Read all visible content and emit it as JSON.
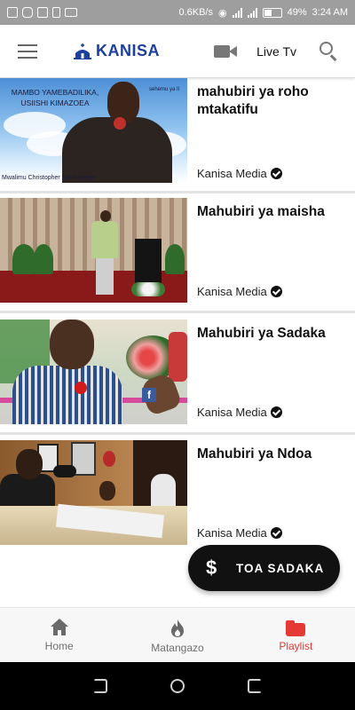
{
  "status_bar": {
    "network_speed": "0.6KB/s",
    "battery": "49%",
    "battery_level": 0.49,
    "time": "3:24 AM"
  },
  "header": {
    "brand": "KANISA",
    "live_tv_label": "Live Tv",
    "icons": {
      "menu": "menu-icon",
      "logo": "church-logo-icon",
      "video": "video-camera-icon",
      "search": "search-icon"
    },
    "brand_color": "#1a3fa0"
  },
  "videos": [
    {
      "title": "mahubiri ya roho mtakatifu",
      "channel": "Kanisa Media",
      "thumbnail": {
        "overlay_text": "MAMBO YAMEBADILIKA, USIISHI KIMAZOEA",
        "tag_text": "sehemu ya II",
        "caption": "Mwalimu Christopher Mwakasege"
      }
    },
    {
      "title": "Mahubiri ya maisha",
      "channel": "Kanisa Media"
    },
    {
      "title": "Mahubiri ya Sadaka",
      "channel": "Kanisa Media"
    },
    {
      "title": "Mahubiri ya Ndoa",
      "channel": "Kanisa Media"
    }
  ],
  "fab": {
    "icon": "dollar-icon",
    "icon_glyph": "$",
    "label": "TOA SADAKA"
  },
  "bottom_nav": {
    "items": [
      {
        "label": "Home",
        "icon": "home-icon",
        "active": false
      },
      {
        "label": "Matangazo",
        "icon": "fire-icon",
        "active": false
      },
      {
        "label": "Playlist",
        "icon": "folder-icon",
        "active": true
      }
    ],
    "active_color": "#e53935"
  }
}
